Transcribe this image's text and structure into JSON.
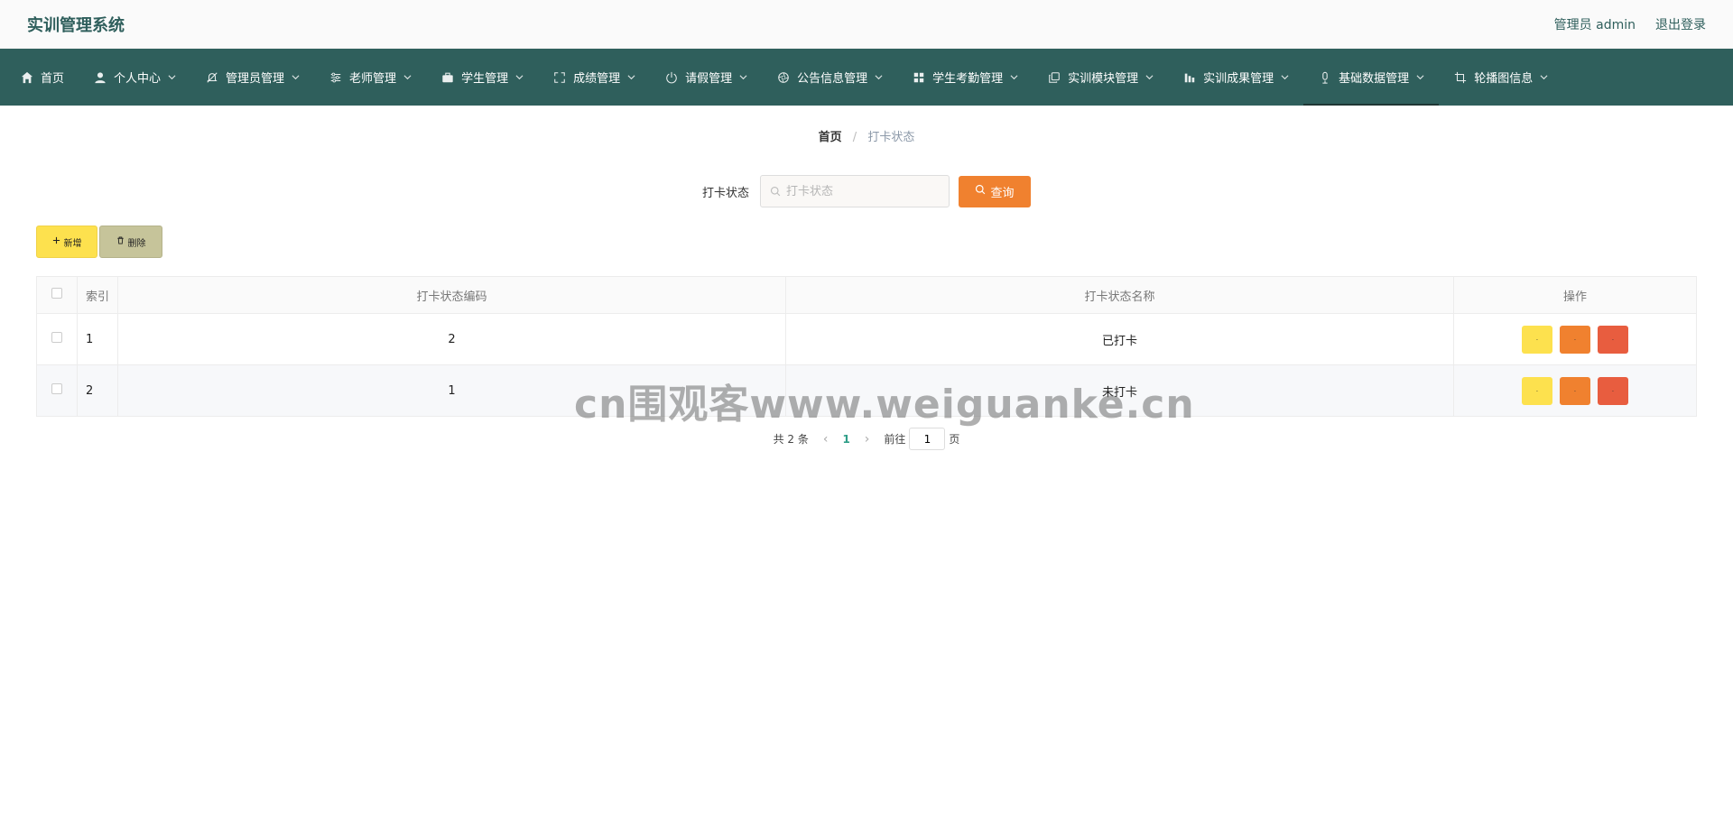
{
  "header": {
    "app_title": "实训管理系统",
    "user_label": "管理员 admin",
    "logout_label": "退出登录"
  },
  "nav": {
    "items": [
      {
        "label": "首页",
        "icon": "home-icon"
      },
      {
        "label": "个人中心",
        "icon": "user-icon"
      },
      {
        "label": "管理员管理",
        "icon": "bell-off-icon"
      },
      {
        "label": "老师管理",
        "icon": "sliders-icon"
      },
      {
        "label": "学生管理",
        "icon": "briefcase-icon"
      },
      {
        "label": "成绩管理",
        "icon": "fullscreen-icon"
      },
      {
        "label": "请假管理",
        "icon": "power-icon"
      },
      {
        "label": "公告信息管理",
        "icon": "aperture-icon"
      },
      {
        "label": "学生考勤管理",
        "icon": "grid-icon"
      },
      {
        "label": "实训模块管理",
        "icon": "copy-icon"
      },
      {
        "label": "实训成果管理",
        "icon": "chart-icon"
      },
      {
        "label": "基础数据管理",
        "icon": "mic-icon"
      },
      {
        "label": "轮播图信息",
        "icon": "crop-icon"
      }
    ]
  },
  "breadcrumb": {
    "home": "首页",
    "separator": "/",
    "current": "打卡状态"
  },
  "search": {
    "label": "打卡状态",
    "placeholder": "打卡状态",
    "query_label": "查询"
  },
  "actions": {
    "add_label": "新增",
    "delete_label": "删除"
  },
  "table": {
    "headers": {
      "index": "索引",
      "code": "打卡状态编码",
      "name": "打卡状态名称",
      "ops": "操作"
    },
    "rows": [
      {
        "index": "1",
        "code": "2",
        "name": "已打卡"
      },
      {
        "index": "2",
        "code": "1",
        "name": "未打卡"
      }
    ],
    "op_labels": {
      "view": "·",
      "edit": "·",
      "delete": "·"
    }
  },
  "pagination": {
    "total": "共 2 条",
    "current_page": "1",
    "goto_prefix": "前往",
    "goto_value": "1",
    "goto_suffix": "页"
  },
  "watermark": "cn围观客www.weiguanke.cn",
  "colors": {
    "nav_bg": "#2f5f5c",
    "query": "#f0812f",
    "add": "#fde14e",
    "delete": "#c6c49a",
    "op_view": "#fde14e",
    "op_edit": "#f0812f",
    "op_delete": "#e85d3f",
    "page_active": "#2f9e88"
  }
}
